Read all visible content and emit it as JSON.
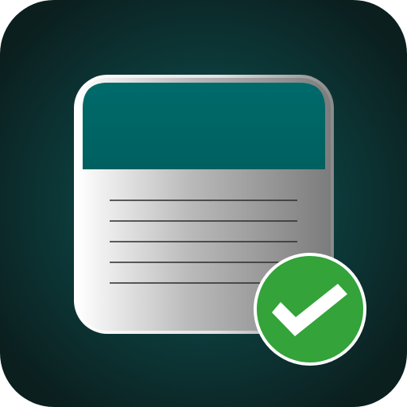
{
  "icon": {
    "name": "notepad-checklist-app-icon",
    "background_center_color": "#0f5a5a",
    "background_edge_color": "#0b1f1f",
    "header_color": "#006868",
    "paper_light_color": "#ffffff",
    "paper_mid_color": "#b9b9b9",
    "paper_dark_color": "#7c7c7c",
    "rule_line_color": "#2b2b2b",
    "ruled_line_count": 5,
    "badge_color": "#33a33a",
    "badge_border_color": "#ffffff",
    "check_color": "#ffffff"
  }
}
